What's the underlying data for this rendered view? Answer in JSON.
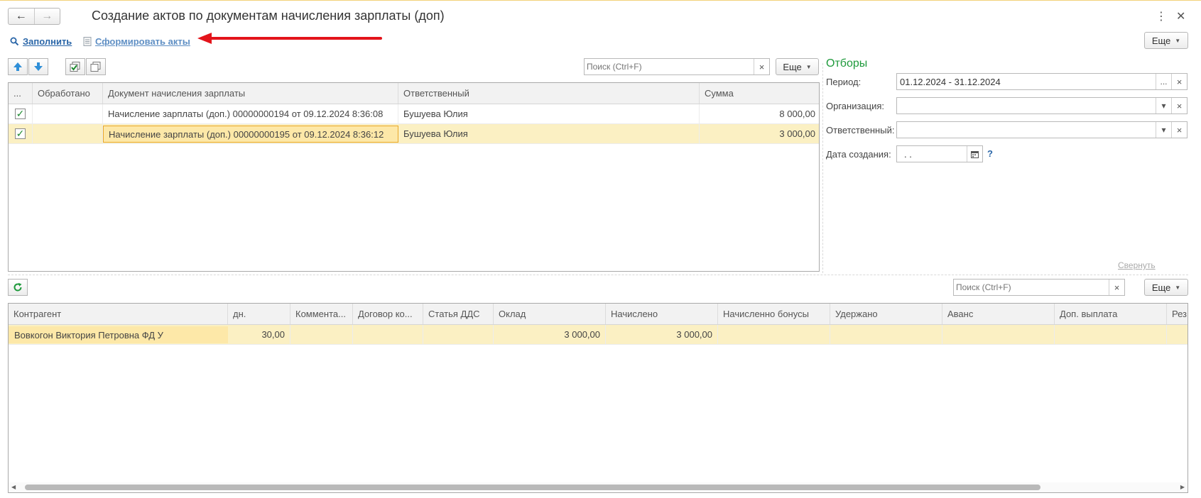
{
  "window": {
    "title": "Создание актов по документам начисления зарплаты (доп)",
    "nav_back": "←",
    "nav_forward": "→",
    "menu_icon": "⋮",
    "close_icon": "✕"
  },
  "commands": {
    "fill_label": "Заполнить",
    "form_acts_label": "Сформировать акты",
    "more_label": "Еще"
  },
  "top_table": {
    "search_placeholder": "Поиск (Ctrl+F)",
    "more_label": "Еще",
    "columns": [
      "...",
      "Обработано",
      "Документ начисления зарплаты",
      "Ответственный",
      "Сумма"
    ],
    "rows": [
      {
        "checked": true,
        "processed": "",
        "document": "Начисление зарплаты (доп.) 00000000194 от 09.12.2024 8:36:08",
        "responsible": "Бушуева Юлия",
        "sum": "8 000,00"
      },
      {
        "checked": true,
        "processed": "",
        "document": "Начисление зарплаты (доп.) 00000000195 от 09.12.2024 8:36:12",
        "responsible": "Бушуева Юлия",
        "sum": "3 000,00"
      }
    ]
  },
  "filters": {
    "title": "Отборы",
    "period_label": "Период:",
    "period_value": "01.12.2024 - 31.12.2024",
    "org_label": "Организация:",
    "org_value": "",
    "resp_label": "Ответственный:",
    "resp_value": "",
    "date_label": "Дата создания:",
    "date_value": " .  .",
    "help": "?",
    "collapse_label": "Свернуть"
  },
  "bottom_table": {
    "search_placeholder": "Поиск (Ctrl+F)",
    "more_label": "Еще",
    "columns": [
      "Контрагент",
      "дн.",
      "Коммента...",
      "Договор ко...",
      "Статья ДДС",
      "Оклад",
      "Начислено",
      "Начисленно бонусы",
      "Удержано",
      "Аванс",
      "Доп. выплата",
      "Рез"
    ],
    "rows": [
      [
        "Вовкогон Виктория Петровна ФД У",
        "30,00",
        "",
        "",
        "",
        "3 000,00",
        "3 000,00",
        "",
        "",
        "",
        "",
        ""
      ]
    ]
  },
  "colors": {
    "accent_green": "#1f9a3c",
    "selection_bg": "#fbf0c3",
    "annotation_red": "#e3141b",
    "link_blue": "#2a66a8"
  }
}
